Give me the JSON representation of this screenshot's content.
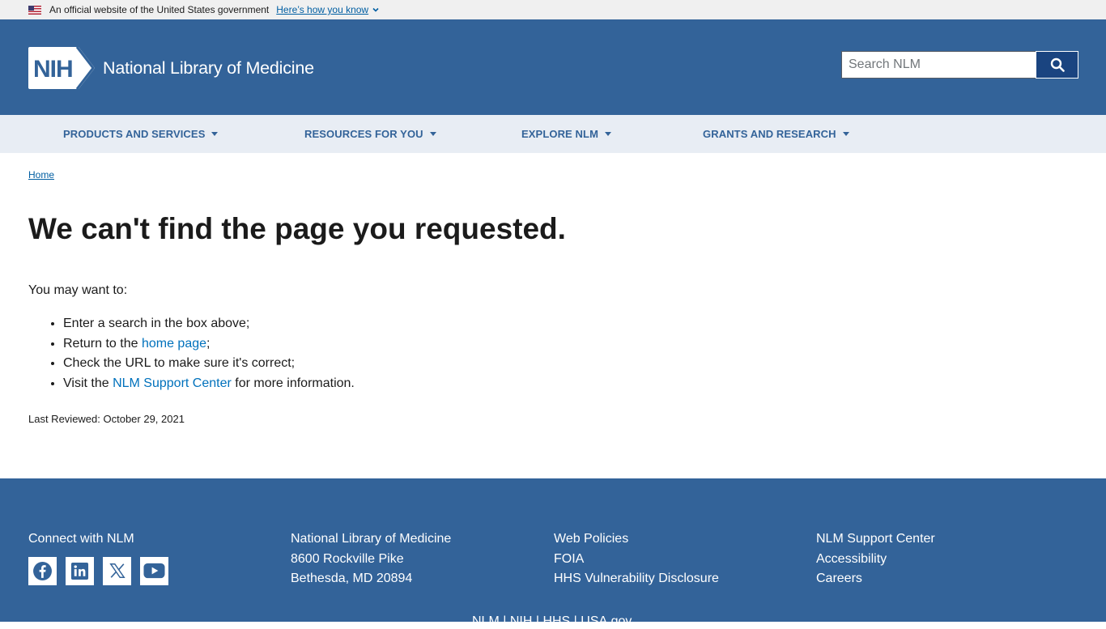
{
  "gov_banner": {
    "text": "An official website of the United States government",
    "link": "Here’s how you know"
  },
  "header": {
    "logo_badge": "NIH",
    "logo_text": "National Library of Medicine",
    "search_placeholder": "Search NLM"
  },
  "nav": {
    "items": [
      {
        "label": "PRODUCTS AND SERVICES"
      },
      {
        "label": "RESOURCES FOR YOU"
      },
      {
        "label": "EXPLORE NLM"
      },
      {
        "label": "GRANTS AND RESEARCH"
      }
    ]
  },
  "breadcrumb": {
    "home": "Home"
  },
  "main": {
    "title": "We can't find the page you requested.",
    "intro": "You may want to:",
    "item1": "Enter a search in the box above;",
    "item2_prefix": "Return to the ",
    "item2_link": "home page",
    "item2_suffix": ";",
    "item3": "Check the URL to make sure it's correct;",
    "item4_prefix": "Visit the ",
    "item4_link": "NLM Support Center",
    "item4_suffix": " for more information.",
    "last_reviewed": "Last Reviewed: October 29, 2021"
  },
  "footer": {
    "connect_heading": "Connect with NLM",
    "social": [
      "facebook-icon",
      "linkedin-icon",
      "x-icon",
      "youtube-icon"
    ],
    "address": [
      "National Library of Medicine",
      "8600 Rockville Pike",
      "Bethesda, MD 20894"
    ],
    "policies": [
      "Web Policies",
      "FOIA",
      "HHS Vulnerability Disclosure"
    ],
    "support": [
      "NLM Support Center",
      "Accessibility",
      "Careers"
    ],
    "bottom_links": [
      "NLM",
      "NIH",
      "HHS",
      "USA.gov"
    ],
    "separator": " | "
  },
  "colors": {
    "header_bg": "#336399",
    "nav_bg": "#e8edf4",
    "link": "#005ea2",
    "search_button": "#1a4480"
  }
}
